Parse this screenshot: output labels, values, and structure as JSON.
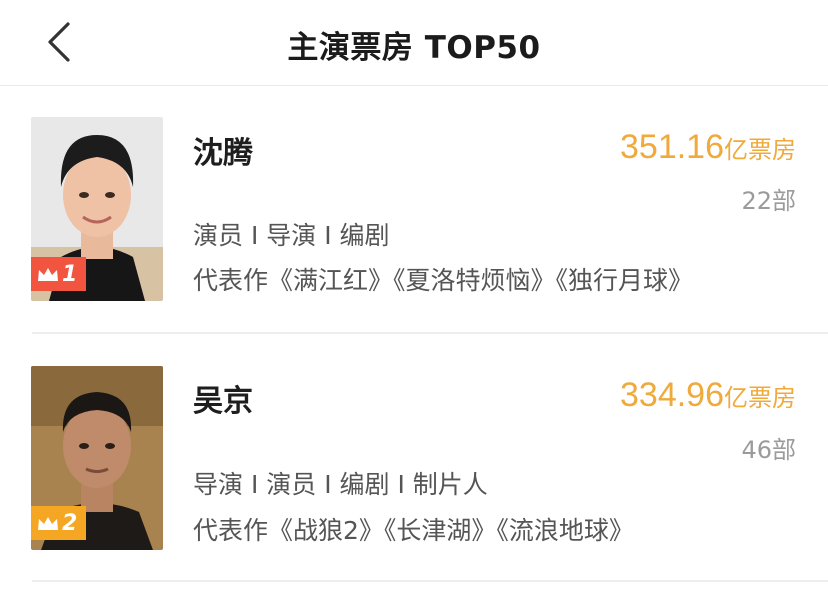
{
  "header": {
    "title": "主演票房 TOP50",
    "back_icon": "chevron-left-icon"
  },
  "colors": {
    "box_office_accent": "#f0a93b",
    "rank_1_badge": "#f2553f",
    "rank_2_badge": "#f5a623"
  },
  "actors": [
    {
      "rank": "1",
      "name": "沈腾",
      "box_office_value": "351.16",
      "box_office_unit": "亿票房",
      "film_count": "22部",
      "roles": "演员 I 导演 I 编剧",
      "works": "代表作《满江红》《夏洛特烦恼》《独行月球》"
    },
    {
      "rank": "2",
      "name": "吴京",
      "box_office_value": "334.96",
      "box_office_unit": "亿票房",
      "film_count": "46部",
      "roles": "导演 I 演员 I 编剧 I 制片人",
      "works": "代表作《战狼2》《长津湖》《流浪地球》"
    }
  ]
}
